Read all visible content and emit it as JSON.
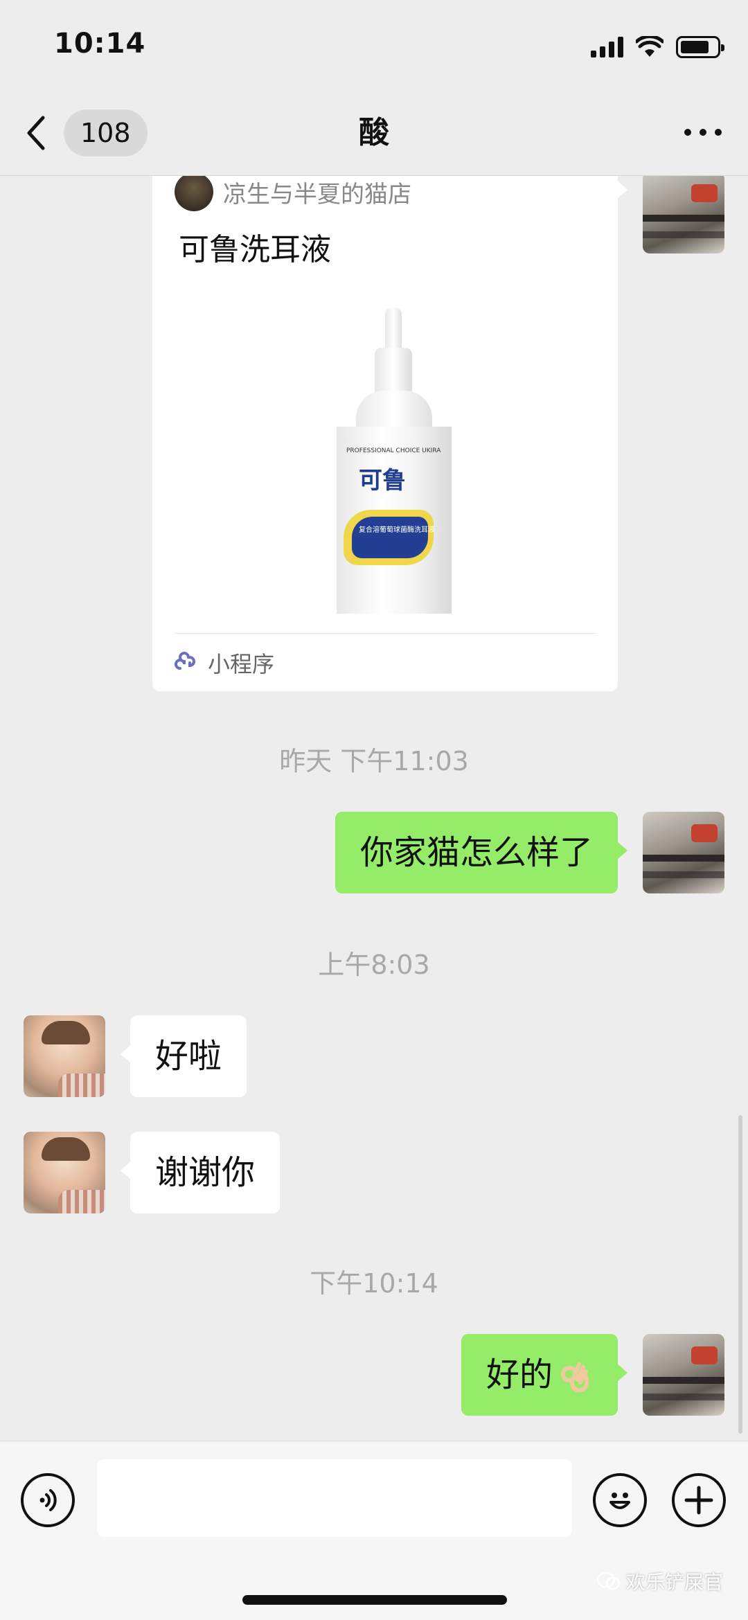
{
  "status_bar": {
    "time": "10:14"
  },
  "header": {
    "unread_count": "108",
    "title": "酸"
  },
  "card": {
    "shop_name": "凉生与半夏的猫店",
    "title": "可鲁洗耳液",
    "product_image": {
      "top_text": "PROFESSIONAL CHOICE UKIRA",
      "brand": "可鲁",
      "label_text": "复合溶葡萄球菌酶洗耳液"
    },
    "footer_label": "小程序"
  },
  "messages": [
    {
      "type": "time",
      "text": "昨天 下午11:03"
    },
    {
      "type": "out",
      "text": "你家猫怎么样了"
    },
    {
      "type": "time",
      "text": "上午8:03"
    },
    {
      "type": "in",
      "text": "好啦"
    },
    {
      "type": "in",
      "text": "谢谢你"
    },
    {
      "type": "time",
      "text": "下午10:14"
    },
    {
      "type": "out",
      "text": "好的",
      "emoji": "ok-hand"
    }
  ],
  "input_bar": {
    "left_icon": "voice-icon",
    "right_icons": [
      "emoji-icon",
      "plus-icon"
    ]
  },
  "watermark": "欢乐铲屎官",
  "colors": {
    "background": "#ededed",
    "outgoing_bubble": "#95ec69",
    "incoming_bubble": "#ffffff",
    "timestamp": "#a8a8a8"
  }
}
